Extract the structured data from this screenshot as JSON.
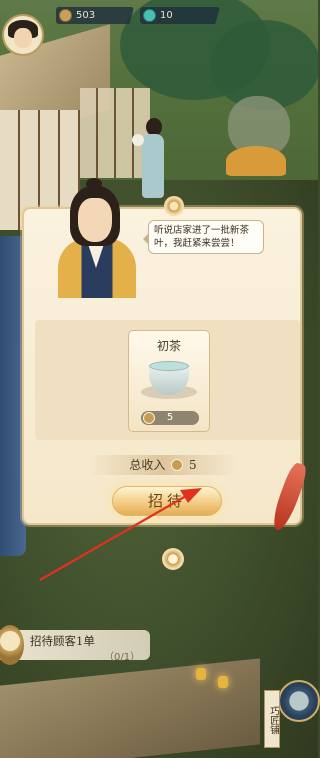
{
  "hud": {
    "coins": "503",
    "jade": "10"
  },
  "dialog": {
    "speech": "听说店家进了一批新茶叶，我赶紧来尝尝！",
    "item": {
      "name": "初茶",
      "price": "5"
    },
    "total_label": "总收入",
    "total_value": "5",
    "action_label": "招待"
  },
  "quest": {
    "label": "招待顾客1单",
    "progress": "（0/1）"
  },
  "shop": {
    "label": "巧匠铺"
  },
  "icons": {
    "coin": "coin-icon",
    "jade": "jade-icon",
    "tea": "tea-cup-icon",
    "pointer": "red-arrow-icon"
  },
  "colors": {
    "panel": "#f7ecd4",
    "button": "#f5d18c",
    "arrow": "#e0311f"
  }
}
